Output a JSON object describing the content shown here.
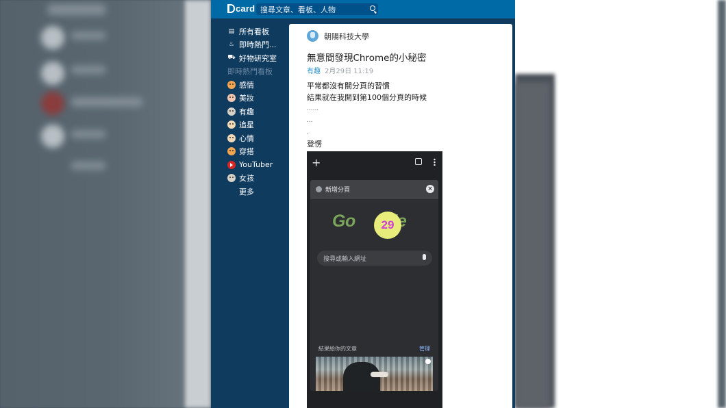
{
  "app": {
    "logo": "card",
    "search_placeholder": "搜尋文章、看板、人物"
  },
  "sidebar": {
    "top_items": [
      {
        "label": "所有看板",
        "icon": "boards-icon"
      },
      {
        "label": "即時熱門...",
        "icon": "fire-icon"
      },
      {
        "label": "好物研究室",
        "icon": "cart-icon"
      }
    ],
    "section_title": "即時熱門看板",
    "boards": [
      {
        "label": "感情",
        "icon": "relationship-emoji-icon"
      },
      {
        "label": "美妝",
        "icon": "makeup-emoji-icon"
      },
      {
        "label": "有趣",
        "icon": "funny-emoji-icon"
      },
      {
        "label": "追星",
        "icon": "idol-emoji-icon"
      },
      {
        "label": "心情",
        "icon": "mood-emoji-icon"
      },
      {
        "label": "穿搭",
        "icon": "dressup-emoji-icon"
      },
      {
        "label": "YouTuber",
        "icon": "youtube-icon"
      },
      {
        "label": "女孩",
        "icon": "girl-emoji-icon"
      }
    ],
    "more": "更多"
  },
  "post": {
    "school": "朝陽科技大學",
    "title": "無意間發現Chrome的小秘密",
    "board": "有趣",
    "date": "2月29日 11:19",
    "lines": [
      "平常都沒有關分頁的習慣",
      "結果就在我開到第100個分頁的時候",
      "......",
      "...",
      ".",
      "登愣"
    ]
  },
  "phone_screenshot": {
    "tab_title": "新增分頁",
    "logo_left": "Go",
    "doodle_number": "29",
    "logo_right": "gle",
    "omnibox_placeholder": "搜尋或輸入網址",
    "feed_heading": "結果給你的文章",
    "feed_manage": "管理"
  }
}
